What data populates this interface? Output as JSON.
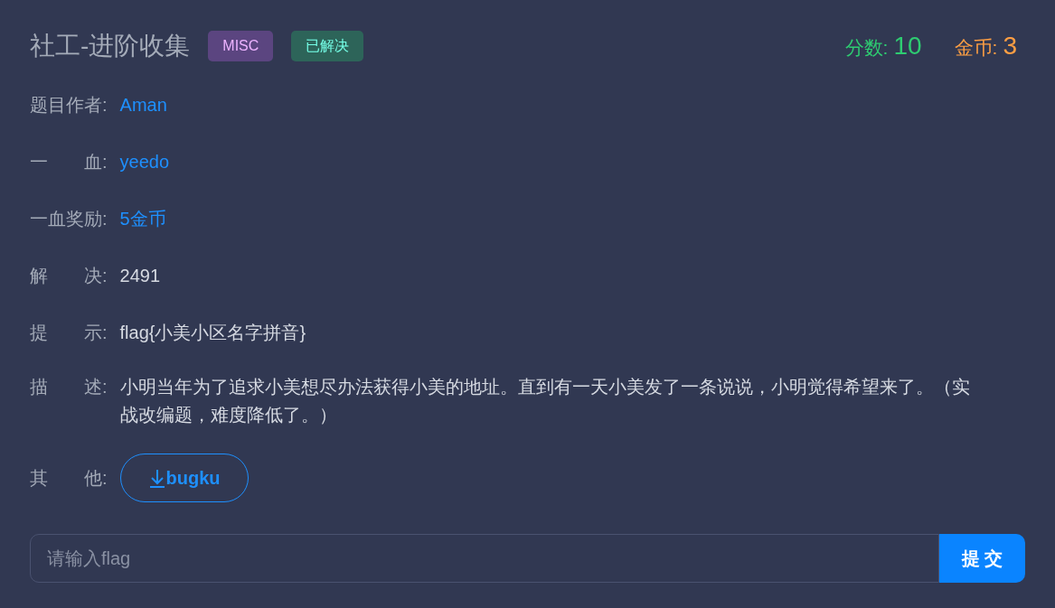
{
  "title": "社工-进阶收集",
  "tags": [
    {
      "text": "MISC",
      "color": "#5b4580"
    },
    {
      "text": "已解决",
      "color": "#2d6459"
    }
  ],
  "stats": [
    {
      "label": "分数:",
      "value": "10",
      "color": "#2ecc71"
    },
    {
      "label": "金币:",
      "value": "3",
      "color": "#ff9f43"
    }
  ],
  "fields": [
    {
      "label": "题目作者:",
      "value": "Aman",
      "kind": "link"
    },
    {
      "label": "一　　血:",
      "value": "yeedo",
      "kind": "link"
    },
    {
      "label": "一血奖励:",
      "value": "5金币",
      "kind": "link"
    },
    {
      "label": "解　　决:",
      "value": "2491",
      "kind": "text"
    },
    {
      "label": "提　　示:",
      "value": "flag{小美小区名字拼音}",
      "kind": "text"
    },
    {
      "label": "描　　述:",
      "value": "小明当年为了追求小美想尽办法获得小美的地址。直到有一天小美发了一条说说，小明觉得希望来了。（实战改编题，难度降低了。）",
      "kind": "paragraph"
    },
    {
      "label": "其　　他:",
      "value": "bugku",
      "kind": "download"
    }
  ],
  "flag_input": {
    "placeholder": "请输入flag"
  },
  "submit": "提 交"
}
